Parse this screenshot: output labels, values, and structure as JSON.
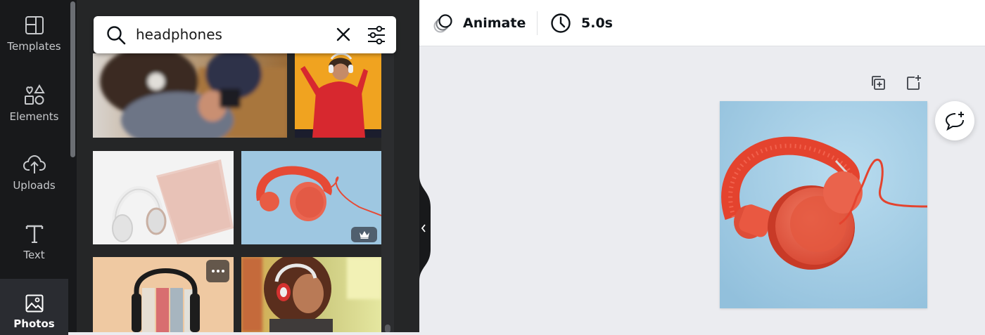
{
  "sidebar": {
    "items": [
      {
        "label": "Templates",
        "icon": "templates-icon"
      },
      {
        "label": "Elements",
        "icon": "elements-icon"
      },
      {
        "label": "Uploads",
        "icon": "uploads-icon"
      },
      {
        "label": "Text",
        "icon": "text-icon"
      },
      {
        "label": "Photos",
        "icon": "photos-icon",
        "active": true
      }
    ]
  },
  "search": {
    "value": "headphones",
    "icons": [
      "search-icon",
      "clear-icon",
      "filter-icon"
    ]
  },
  "results": {
    "items": [
      {
        "name": "photo-woman-phone-headphones"
      },
      {
        "name": "photo-woman-red-sweater-headphones"
      },
      {
        "name": "photo-white-headphones-laptop"
      },
      {
        "name": "photo-red-headphones-blue",
        "badge": "crown-icon"
      },
      {
        "name": "photo-headphones-books",
        "badge": "more-icon"
      },
      {
        "name": "photo-woman-curly-hair-headphones"
      }
    ]
  },
  "toolbar": {
    "animate_label": "Animate",
    "duration_label": "5.0s",
    "icons": [
      "animate-icon",
      "clock-icon"
    ]
  },
  "canvas": {
    "page_tools": [
      "duplicate-page-icon",
      "add-page-icon"
    ],
    "comment_icon": "add-comment-icon",
    "background": "#a9cfe6",
    "accent": "#e8523f"
  }
}
